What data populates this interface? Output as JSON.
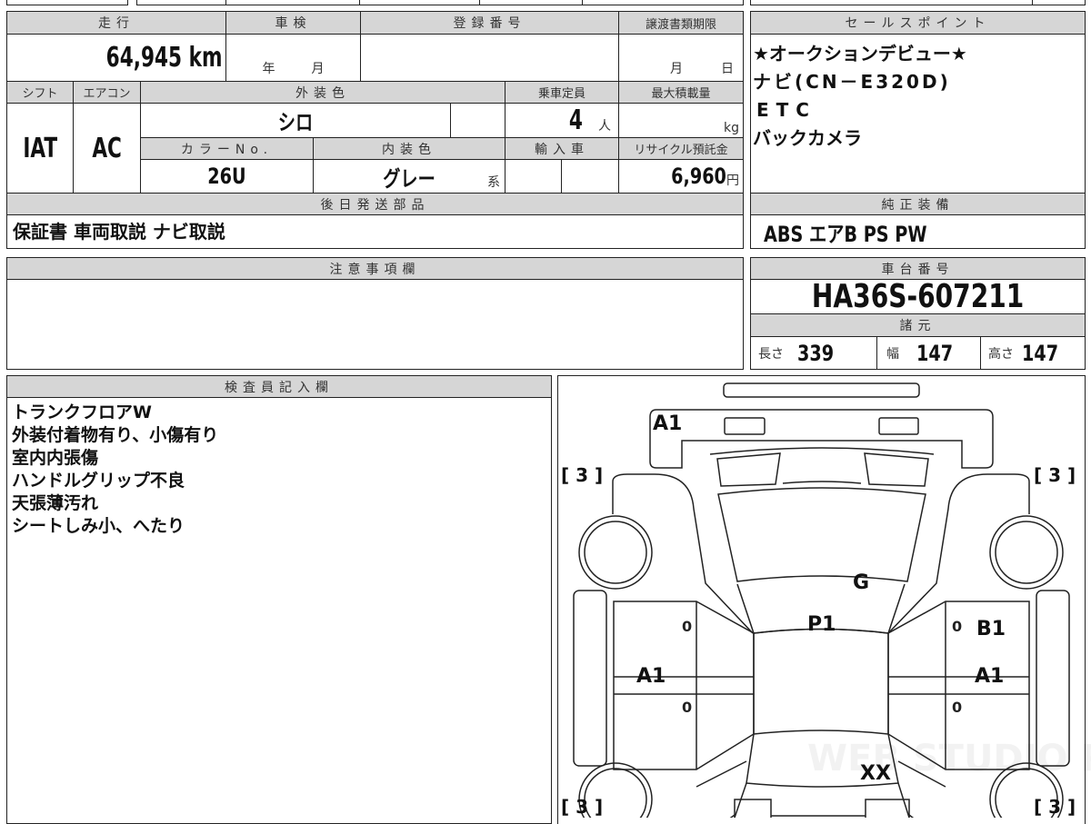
{
  "vehicle_info": {
    "mileage": {
      "label": "走行",
      "value": "64,945",
      "unit": "km"
    },
    "inspection": {
      "label": "車検",
      "year_unit": "年",
      "month_unit": "月"
    },
    "registration_number": {
      "label": "登録番号",
      "value": ""
    },
    "transfer_deadline": {
      "label": "譲渡書類期限",
      "month_unit": "月",
      "day_unit": "日"
    },
    "shift": {
      "label": "シフト",
      "value": "IAT"
    },
    "aircon": {
      "label": "エアコン",
      "value": "AC"
    },
    "exterior_color": {
      "label": "外装色",
      "value": "シロ"
    },
    "capacity": {
      "label": "乗車定員",
      "value": "4",
      "unit": "人"
    },
    "max_load": {
      "label": "最大積載量",
      "unit": "kg"
    },
    "color_no": {
      "label": "カラーNo.",
      "value": "26U"
    },
    "interior_color": {
      "label": "内装色",
      "value": "グレー",
      "suffix": "系"
    },
    "import": {
      "label": "輸入車"
    },
    "recycle_fee": {
      "label": "リサイクル預託金",
      "value": "6,960",
      "unit": "円"
    },
    "later_parts": {
      "label": "後日発送部品",
      "value": "保証書 車両取説 ナビ取説"
    }
  },
  "sales_points": {
    "label": "セールスポイント",
    "items": [
      "★オークションデビュー★",
      "ナビ(CN－E320D)",
      "ETC",
      "バックカメラ"
    ]
  },
  "standard_equipment": {
    "label": "純正装備",
    "value": "ABS エアB PS PW"
  },
  "notes": {
    "label": "注意事項欄",
    "value": ""
  },
  "chassis": {
    "label": "車台番号",
    "value": "HA36S-607211"
  },
  "specs": {
    "label": "諸元",
    "length": {
      "label": "長さ",
      "value": "339"
    },
    "width": {
      "label": "幅",
      "value": "147"
    },
    "height": {
      "label": "高さ",
      "value": "147"
    }
  },
  "inspector": {
    "label": "検査員記入欄",
    "lines": [
      "トランクフロアW",
      "外装付着物有り、小傷有り",
      "室内内張傷",
      "ハンドルグリップ不良",
      "天張薄汚れ",
      "シートしみ小、へたり"
    ]
  },
  "diagram": {
    "front_bumper": "A1",
    "windshield_lower": "G",
    "roof": "P1",
    "right_front_door": "B1",
    "left_rear_door": "A1",
    "right_rear_door": "A1",
    "trunk": "XX",
    "door_marks": [
      "0",
      "0",
      "0",
      "0"
    ],
    "tire_tread": [
      "3",
      "3",
      "3",
      "3"
    ],
    "watermark": "WEB STUDIO PRO"
  }
}
